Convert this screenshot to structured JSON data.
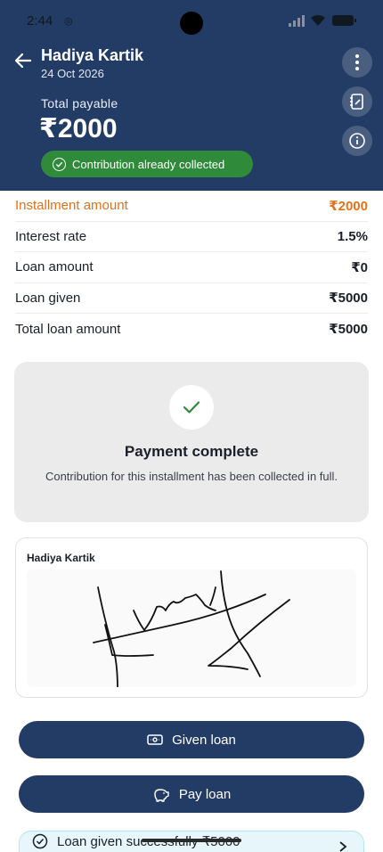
{
  "status_bar": {
    "time": "2:44",
    "nfc_glyph": "◎"
  },
  "header": {
    "name": "Hadiya Kartik",
    "date": "24 Oct 2026",
    "total_label": "Total payable",
    "total_amount": "₹2000",
    "badge_label": "Contribution already collected"
  },
  "details": [
    {
      "label": "Installment amount",
      "value": "₹2000",
      "accent": true
    },
    {
      "label": "Interest rate",
      "value": "1.5%"
    },
    {
      "label": "Loan amount",
      "value": "₹0"
    },
    {
      "label": "Loan given",
      "value": "₹5000"
    },
    {
      "label": "Total loan amount",
      "value": "₹5000"
    }
  ],
  "payment_card": {
    "title": "Payment complete",
    "description": "Contribution for this installment has been collected in full."
  },
  "signature": {
    "name": "Hadiya Kartik"
  },
  "buttons": {
    "given_loan": "Given loan",
    "pay_loan": "Pay loan"
  },
  "toast": {
    "message": "Loan given successfully ₹5000"
  },
  "colors": {
    "header_bg": "#233c65",
    "accent": "#e0721b",
    "success": "#2f8a3a",
    "toast_bg": "#e6f6fb"
  }
}
